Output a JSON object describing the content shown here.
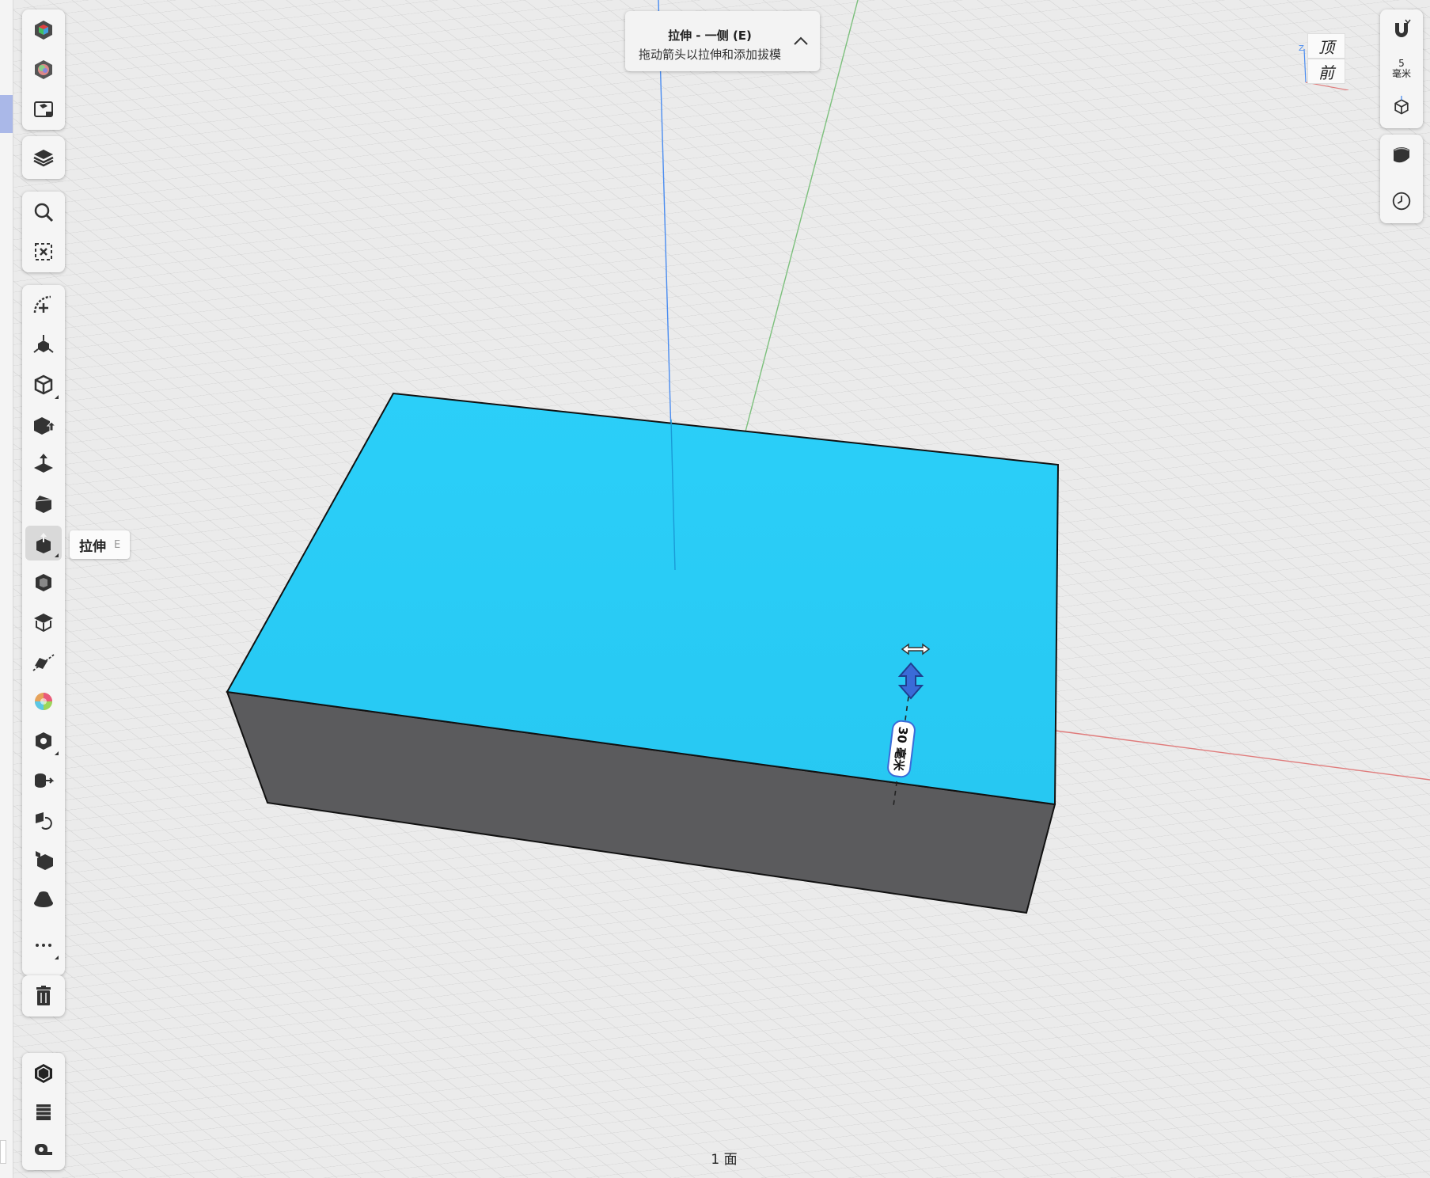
{
  "hint": {
    "title": "拉伸 - 一侧 (E)",
    "subtitle": "拖动箭头以拉伸和添加拔模"
  },
  "tooltip": {
    "label": "拉伸",
    "shortcut": "E"
  },
  "dimension": {
    "value": "30 毫米"
  },
  "snap": {
    "value": "5",
    "unit": "毫米"
  },
  "viewcube": {
    "top": "顶",
    "front": "前",
    "axis_z": "Z"
  },
  "status": {
    "selection": "1 面"
  },
  "colors": {
    "top_face": "#2bd0f8",
    "side_face": "#5b5b5d",
    "grid_bg": "#ebebeb",
    "axis_x": "#e07b7b",
    "axis_y": "#7cc07c",
    "axis_z": "#4a8cf0",
    "handle_blue": "#3a6bd8"
  },
  "left_toolbar": [
    {
      "name": "appearance-icon"
    },
    {
      "name": "color-wheel-icon"
    },
    {
      "name": "render-settings-icon"
    },
    {
      "name": "layers-icon"
    },
    {
      "name": "search-icon"
    },
    {
      "name": "deselect-icon"
    },
    {
      "name": "sketch-arc-icon"
    },
    {
      "name": "transform-icon"
    },
    {
      "name": "primitives-icon"
    },
    {
      "name": "push-pull-icon"
    },
    {
      "name": "extrude-face-icon"
    },
    {
      "name": "chamfer-icon"
    },
    {
      "name": "extrude-icon"
    },
    {
      "name": "shell-icon"
    },
    {
      "name": "offset-face-icon"
    },
    {
      "name": "section-icon"
    },
    {
      "name": "material-icon"
    },
    {
      "name": "boolean-icon"
    },
    {
      "name": "sweep-icon"
    },
    {
      "name": "revolve-icon"
    },
    {
      "name": "split-icon"
    },
    {
      "name": "loft-icon"
    },
    {
      "name": "more-icon"
    },
    {
      "name": "delete-icon"
    }
  ]
}
